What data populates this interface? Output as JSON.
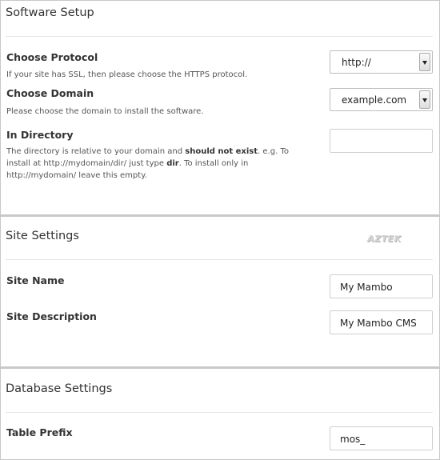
{
  "software_setup": {
    "title": "Software Setup",
    "protocol": {
      "label": "Choose Protocol",
      "description": "If your site has SSL, then please choose the HTTPS protocol.",
      "value": "http://"
    },
    "domain": {
      "label": "Choose Domain",
      "description": "Please choose the domain to install the software.",
      "value": "example.com"
    },
    "directory": {
      "label": "In Directory",
      "desc_part1": "The directory is relative to your domain and ",
      "desc_bold1": "should not exist",
      "desc_part2": ". e.g. To install at http://mydomain/dir/ just type ",
      "desc_bold2": "dir",
      "desc_part3": ". To install only in http://mydomain/ leave this empty.",
      "value": ""
    }
  },
  "site_settings": {
    "title": "Site Settings",
    "logo_text": "AZTEK",
    "site_name": {
      "label": "Site Name",
      "value": "My Mambo"
    },
    "site_description": {
      "label": "Site Description",
      "value": "My Mambo CMS"
    }
  },
  "database_settings": {
    "title": "Database Settings",
    "table_prefix": {
      "label": "Table Prefix",
      "value": "mos_"
    }
  }
}
